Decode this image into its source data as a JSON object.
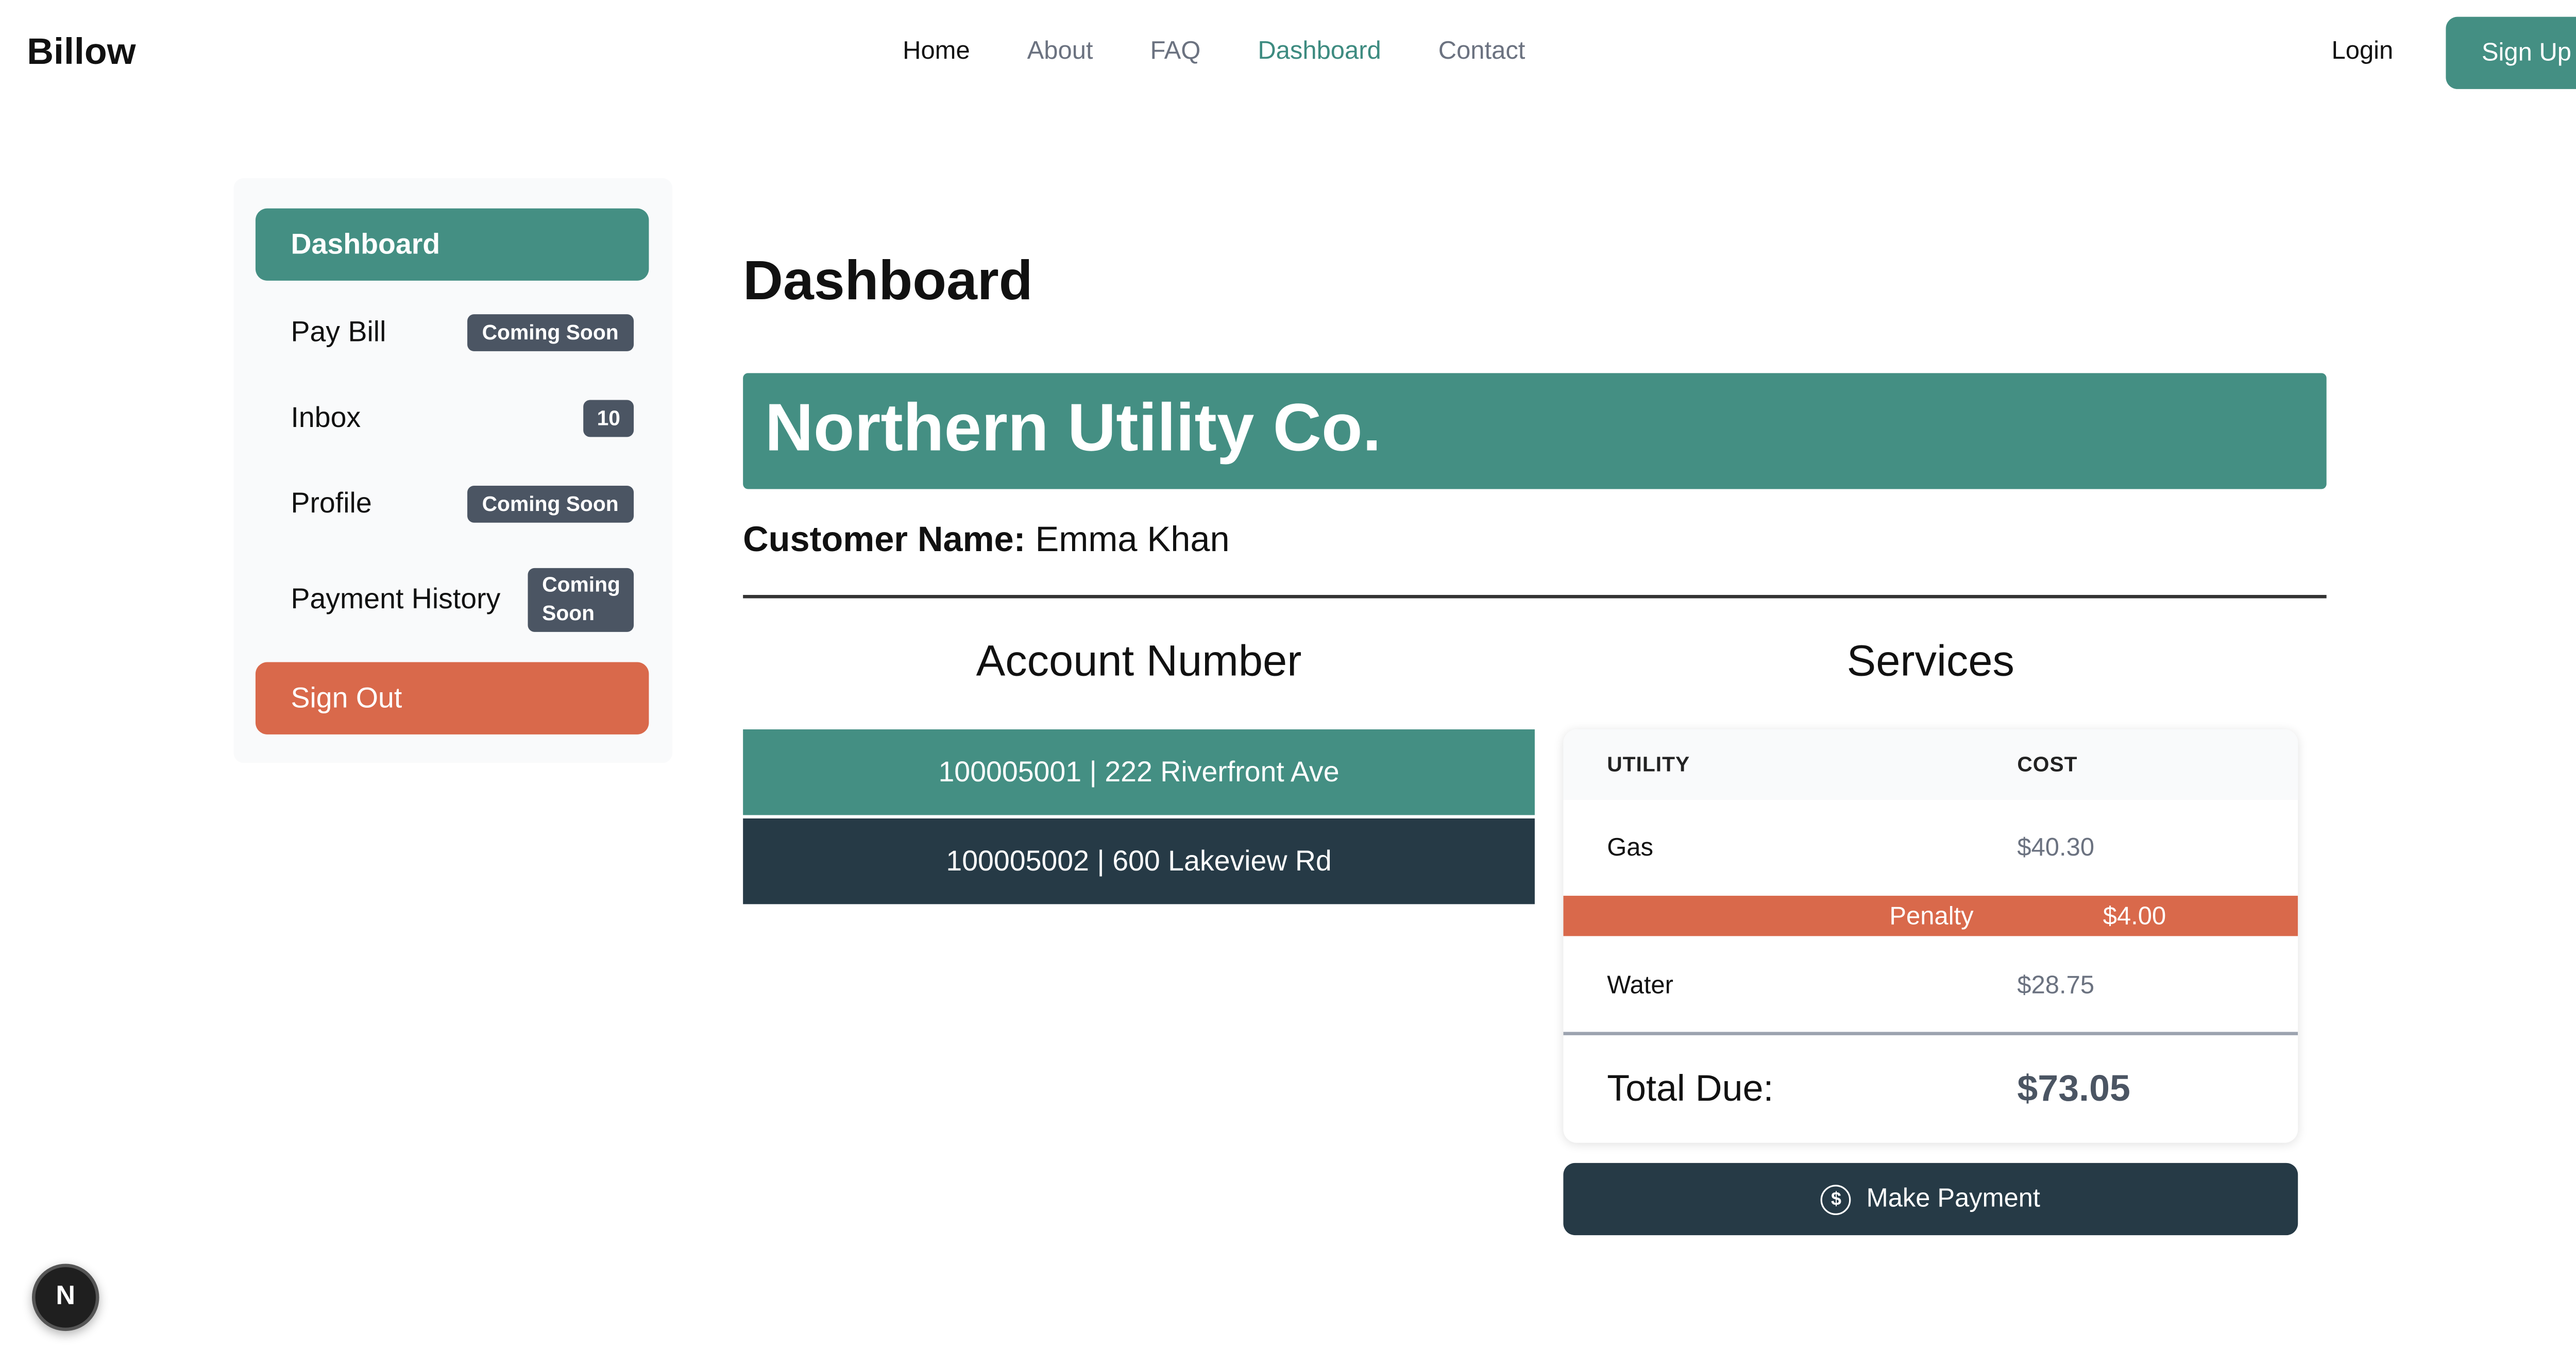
{
  "nav": {
    "brand": "Billow",
    "links": [
      "Home",
      "About",
      "FAQ",
      "Dashboard",
      "Contact"
    ],
    "login": "Login",
    "signup": "Sign Up",
    "active_color": "#3d8b80"
  },
  "sidebar": {
    "items": [
      {
        "label": "Dashboard",
        "badge": ""
      },
      {
        "label": "Pay Bill",
        "badge": "Coming Soon"
      },
      {
        "label": "Inbox",
        "badge": "10"
      },
      {
        "label": "Profile",
        "badge": "Coming Soon"
      },
      {
        "label": "Payment History",
        "badge": "Coming Soon"
      },
      {
        "label": "Sign Out",
        "badge": ""
      }
    ],
    "payment_history_badge_line1": "Coming",
    "payment_history_badge_line2": "Soon"
  },
  "main": {
    "title": "Dashboard",
    "company": "Northern Utility Co.",
    "customer_label": "Customer Name:",
    "customer_name": "Emma Khan",
    "account_heading": "Account Number",
    "accounts": [
      "100005001 | 222 Riverfront Ave",
      "100005002 | 600 Lakeview Rd"
    ],
    "services_heading": "Services",
    "services_table": {
      "headers": [
        "UTILITY",
        "COST"
      ],
      "rows": [
        {
          "utility": "Gas",
          "cost": "$40.30"
        },
        {
          "utility": "Water",
          "cost": "$28.75"
        }
      ],
      "penalty_label": "Penalty",
      "penalty_value": "$4.00",
      "total_label": "Total Due:",
      "total_value": "$73.05"
    },
    "pay_button": "Make Payment",
    "pay_icon": "dollar-circle-icon"
  },
  "floating": {
    "badge_letter": "N"
  },
  "colors": {
    "primary": "#448f83",
    "danger": "#d9694b",
    "dark": "#263a46"
  }
}
